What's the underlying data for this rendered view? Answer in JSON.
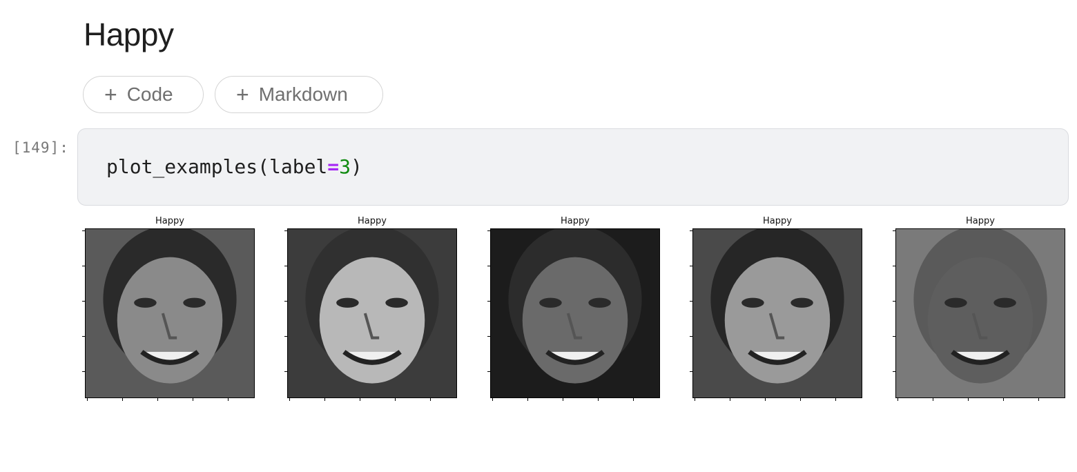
{
  "heading": "Happy",
  "toolbar": {
    "add_code_icon": "plus-icon",
    "add_code_label": "Code",
    "add_markdown_icon": "plus-icon",
    "add_markdown_label": "Markdown"
  },
  "cell": {
    "execution_count": "[149]:",
    "code": {
      "func": "plot_examples(label",
      "op": "=",
      "num": "3",
      "close": ")"
    }
  },
  "output": {
    "images": [
      {
        "title": "Happy",
        "tone": "#8a8a8a"
      },
      {
        "title": "Happy",
        "tone": "#b8b8b8"
      },
      {
        "title": "Happy",
        "tone": "#6a6a6a"
      },
      {
        "title": "Happy",
        "tone": "#9a9a9a"
      },
      {
        "title": "Happy",
        "tone": "#5e5e5e"
      }
    ]
  },
  "colors": {
    "code_bg": "#f1f2f4",
    "operator": "#a626f5",
    "number": "#0f8a0f"
  }
}
